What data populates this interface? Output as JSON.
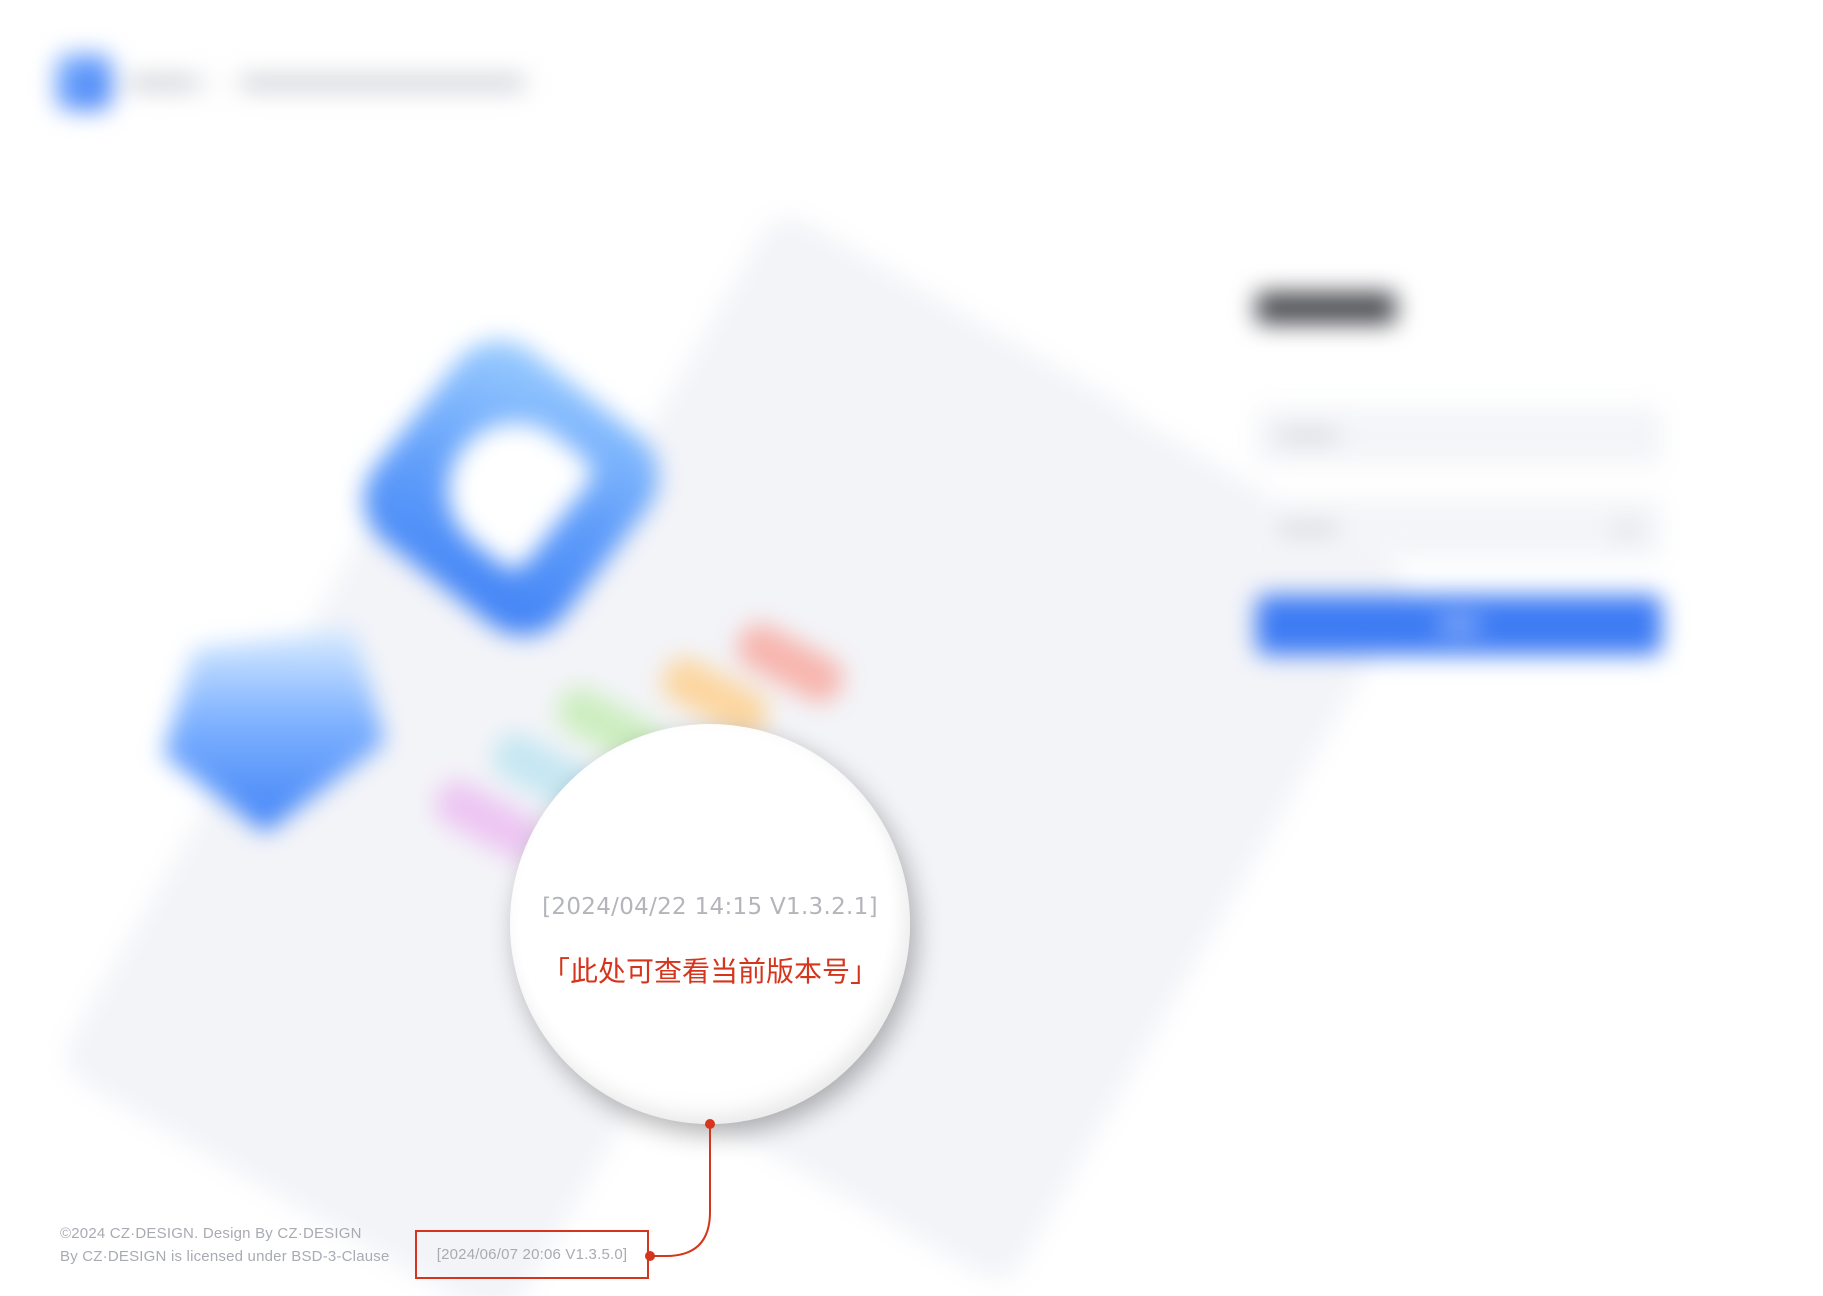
{
  "header": {
    "logo_icon": "app-logo-icon"
  },
  "login_form": {
    "password_toggle_icon": "eye-icon"
  },
  "magnifier": {
    "version": "[2024/04/22 14:15 V1.3.2.1]",
    "note": "「此处可查看当前版本号」"
  },
  "footer": {
    "copyright": "©2024 CZ·DESIGN. Design By CZ·DESIGN",
    "license": "By CZ·DESIGN is licensed under BSD-3-Clause",
    "version": "[2024/06/07 20:06 V1.3.5.0]"
  },
  "colors": {
    "accent": "#3e7cf4",
    "annotation": "#d4351c",
    "background": "#ffffff"
  }
}
